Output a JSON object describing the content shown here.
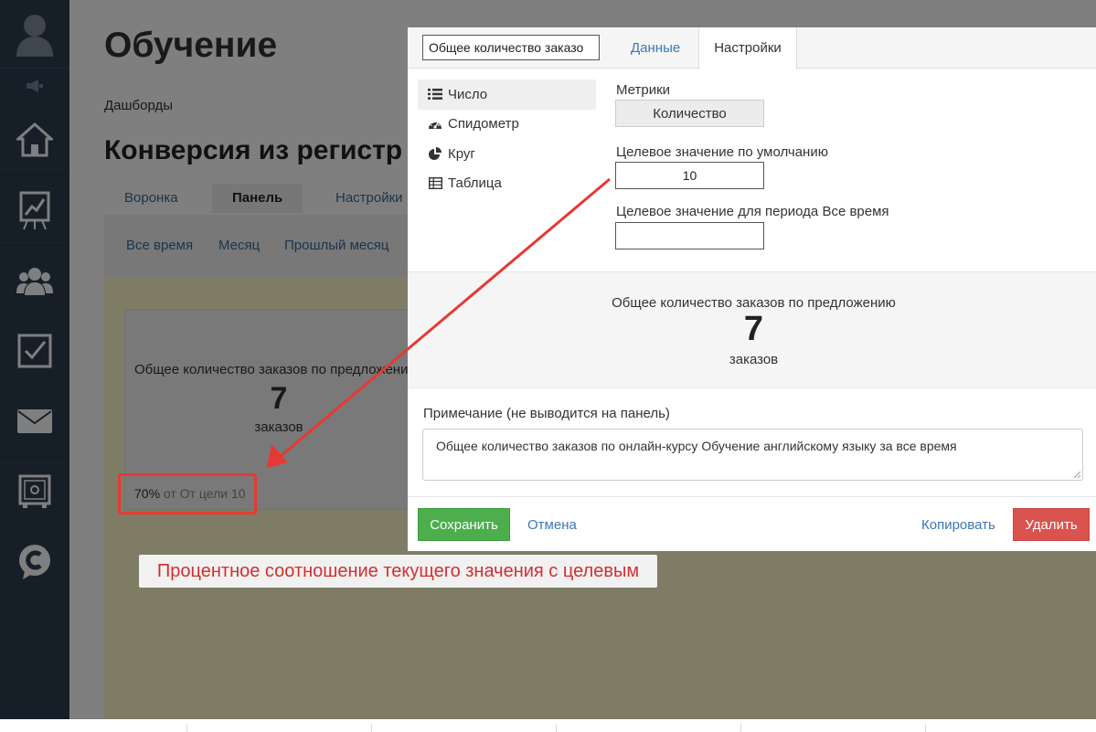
{
  "page": {
    "title": "Обучение",
    "breadcrumb": "Дашборды",
    "subtitle": "Конверсия из регистр",
    "tabs": [
      "Воронка",
      "Панель",
      "Настройки"
    ],
    "periods": [
      "Все время",
      "Месяц",
      "Прошлый месяц"
    ]
  },
  "widget": {
    "name": "Общее количество заказов по предложению",
    "value": "7",
    "unit": "заказов",
    "percent": "70%",
    "percent_note": "от От цели 10"
  },
  "modal": {
    "title_value": "Общее количество заказо",
    "tabs": [
      "Данные",
      "Настройки"
    ],
    "active_tab": "Настройки",
    "viz_types": [
      {
        "label": "Число",
        "icon": "list-icon"
      },
      {
        "label": "Спидометр",
        "icon": "speedometer-icon"
      },
      {
        "label": "Круг",
        "icon": "pie-icon"
      },
      {
        "label": "Таблица",
        "icon": "table-icon"
      }
    ],
    "metrics_label": "Метрики",
    "metric_button": "Количество",
    "default_target_label": "Целевое значение по умолчанию",
    "default_target_value": "10",
    "period_target_label": "Целевое значение для периода Все время",
    "period_target_value": "",
    "preview": {
      "name": "Общее количество заказов по предложению",
      "value": "7",
      "unit": "заказов"
    },
    "note_label": "Примечание (не выводится на панель)",
    "note_value": "Общее количество заказов по онлайн-курсу Обучение английскому языку за все время",
    "buttons": {
      "save": "Сохранить",
      "cancel": "Отмена",
      "copy": "Копировать",
      "delete": "Удалить"
    }
  },
  "annotation": {
    "callout": "Процентное соотношение текущего значения с целевым"
  },
  "colors": {
    "sidebar": "#2c3e50",
    "save": "#4cae4c",
    "delete": "#d9534f",
    "annotation": "#e53935",
    "link": "#3a78b5"
  }
}
